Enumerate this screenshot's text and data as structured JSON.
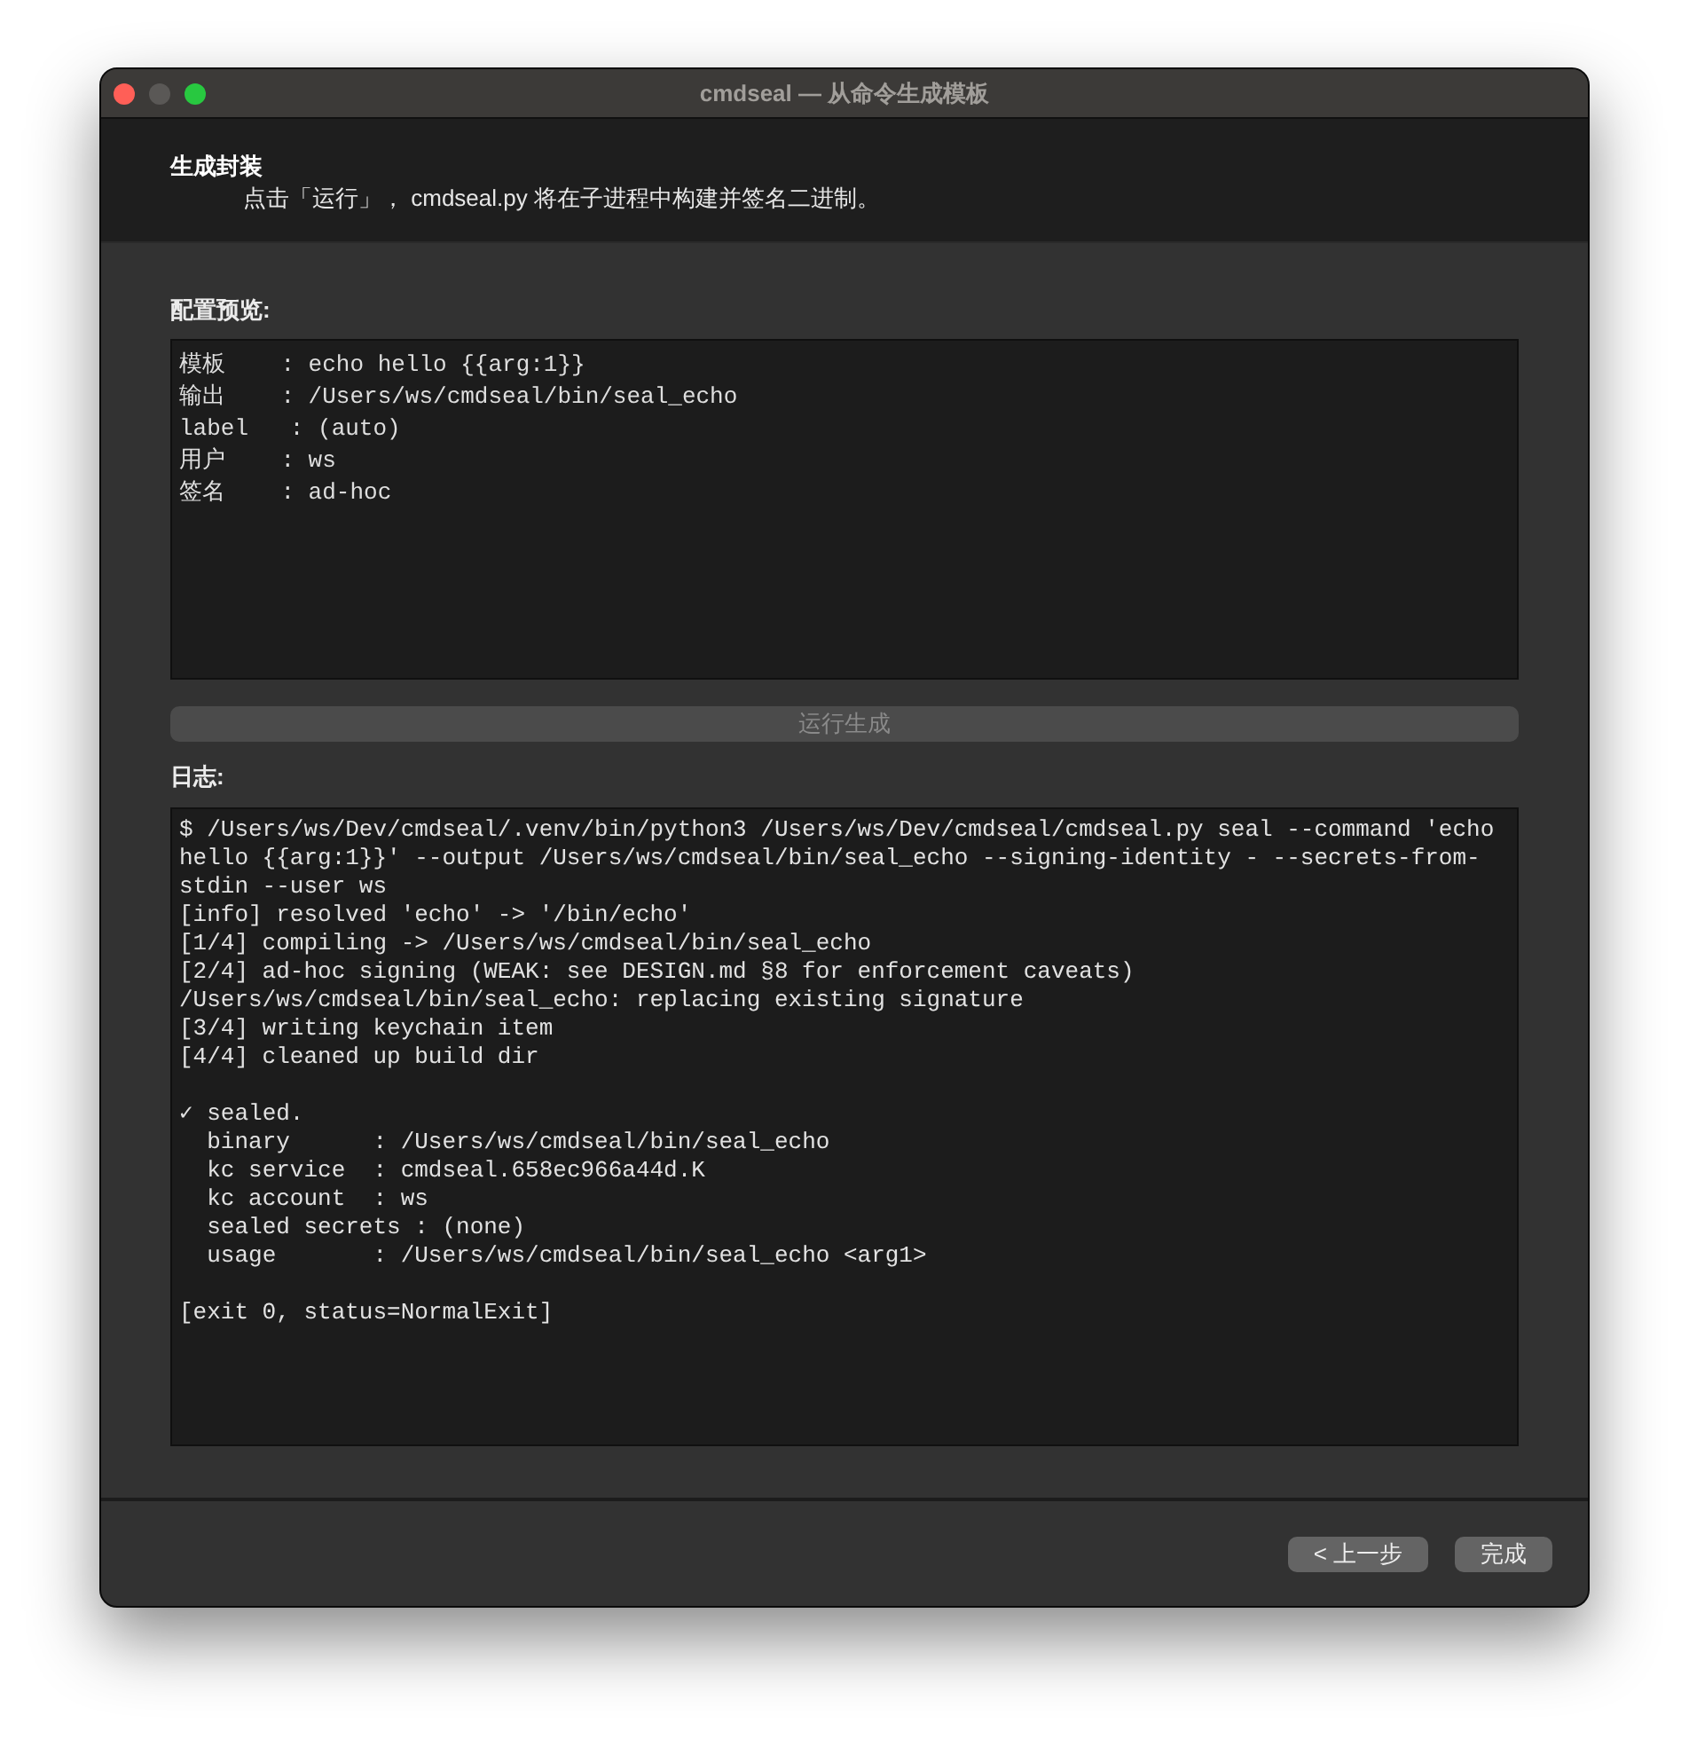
{
  "window": {
    "title": "cmdseal — 从命令生成模板",
    "controls": [
      {
        "kind": "close",
        "disabled": false
      },
      {
        "kind": "minimize",
        "disabled": true
      },
      {
        "kind": "zoom",
        "disabled": false
      }
    ]
  },
  "header": {
    "title": "生成封装",
    "description": "点击「运行」， cmdseal.py 将在子进程中构建并签名二进制。"
  },
  "preview": {
    "label": "配置预览:",
    "lines": [
      "模板    : echo hello {{arg:1}}",
      "输出    : /Users/ws/cmdseal/bin/seal_echo",
      "label   : (auto)",
      "用户    : ws",
      "签名    : ad-hoc"
    ]
  },
  "run_button": {
    "label": "运行生成",
    "disabled": true
  },
  "log": {
    "label": "日志:",
    "sections": [
      {
        "lines": [
          "$ /Users/ws/Dev/cmdseal/.venv/bin/python3 /Users/ws/Dev/cmdseal/cmdseal.py seal --command 'echo hello {{arg:1}}' --output /Users/ws/cmdseal/bin/seal_echo --signing-identity - --secrets-from-stdin --user ws",
          "[info] resolved 'echo' -> '/bin/echo'",
          "[1/4] compiling -> /Users/ws/cmdseal/bin/seal_echo",
          "[2/4] ad-hoc signing (WEAK: see DESIGN.md §8 for enforcement caveats)",
          "/Users/ws/cmdseal/bin/seal_echo: replacing existing signature",
          "[3/4] writing keychain item",
          "[4/4] cleaned up build dir"
        ]
      },
      {
        "lines": [
          "✓ sealed.",
          "  binary      : /Users/ws/cmdseal/bin/seal_echo",
          "  kc service  : cmdseal.658ec966a44d.K",
          "  kc account  : ws",
          "  sealed secrets : (none)",
          "  usage       : /Users/ws/cmdseal/bin/seal_echo <arg1>"
        ]
      },
      {
        "lines": [
          "[exit 0, status=NormalExit]"
        ]
      }
    ]
  },
  "footer": {
    "buttons": [
      {
        "label": "< 上一步",
        "disabled": false
      },
      {
        "label": "完成",
        "disabled": false
      }
    ]
  }
}
